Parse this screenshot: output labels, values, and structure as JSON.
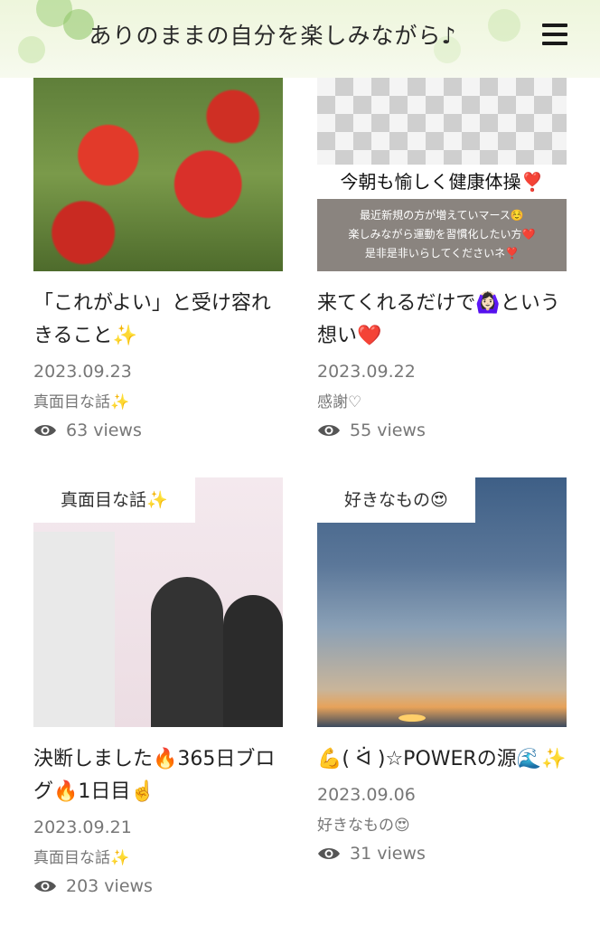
{
  "header": {
    "title": "ありのままの自分を楽しみながら♪"
  },
  "posts": [
    {
      "title": "「これがよい」と受け容れきること✨",
      "date": "2023.09.23",
      "category": "真面目な話✨",
      "views": "63 views",
      "tag": ""
    },
    {
      "title": "来てくれるだけで🙆🏻‍♀️という想い❤️",
      "date": "2023.09.22",
      "category": "感謝♡",
      "views": "55 views",
      "tag": "",
      "image_text": {
        "banner": "今朝も愉しく健康体操❣️",
        "lines": [
          "最近新規の方が増えていマース☺️",
          "楽しみながら運動を習慣化したい方❤️",
          "是非是非いらしてくださいネ❣️"
        ]
      }
    },
    {
      "title": "決断しました🔥365日ブログ🔥1日目☝️",
      "date": "2023.09.21",
      "category": "真面目な話✨",
      "views": "203 views",
      "tag": "真面目な話✨"
    },
    {
      "title": "💪( ᐛ )☆POWERの源🌊✨",
      "date": "2023.09.06",
      "category": "好きなもの😍",
      "views": "31 views",
      "tag": "好きなもの😍"
    }
  ]
}
